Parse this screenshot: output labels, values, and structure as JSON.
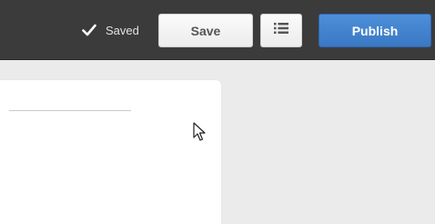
{
  "toolbar": {
    "status_text": "Saved",
    "save_label": "Save",
    "publish_label": "Publish",
    "icons": {
      "status": "checkmark-icon",
      "list": "list-icon"
    },
    "colors": {
      "toolbar_bg": "#3b3b3b",
      "publish_bg": "#3a78c4",
      "save_bg": "#f5f5f5"
    }
  },
  "main": {
    "background": "#ebebeb",
    "panel_bg": "#ffffff"
  }
}
